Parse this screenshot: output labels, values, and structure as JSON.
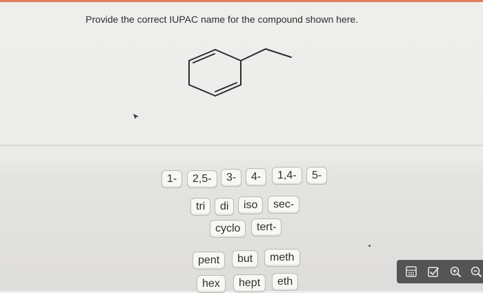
{
  "question": {
    "text": "Provide the correct IUPAC name for the compound shown here."
  },
  "answer_tiles": {
    "locants": [
      "1-",
      "2,5-",
      "3-",
      "4-",
      "1,4-",
      "5-"
    ],
    "multipliers": [
      "tri",
      "di",
      "iso",
      "sec-"
    ],
    "modifiers": [
      "cyclo",
      "tert-"
    ],
    "roots_row1": [
      "pent",
      "but",
      "meth"
    ],
    "roots_row2": [
      "hex",
      "hept",
      "eth"
    ]
  },
  "toolbar": {
    "icons": [
      "calculator-icon",
      "checklist-icon",
      "zoom-in-icon",
      "zoom-out-icon"
    ]
  },
  "colors": {
    "accent": "#e07b5c",
    "tile_border": "#b9b9b5",
    "toolbar_bg": "#545454"
  }
}
